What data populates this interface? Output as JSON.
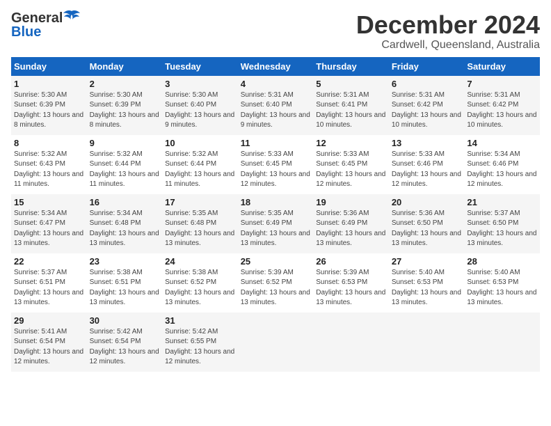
{
  "logo": {
    "general": "General",
    "blue": "Blue"
  },
  "title": "December 2024",
  "subtitle": "Cardwell, Queensland, Australia",
  "weekdays": [
    "Sunday",
    "Monday",
    "Tuesday",
    "Wednesday",
    "Thursday",
    "Friday",
    "Saturday"
  ],
  "weeks": [
    [
      {
        "day": "1",
        "sunrise": "5:30 AM",
        "sunset": "6:39 PM",
        "daylight": "13 hours and 8 minutes."
      },
      {
        "day": "2",
        "sunrise": "5:30 AM",
        "sunset": "6:39 PM",
        "daylight": "13 hours and 8 minutes."
      },
      {
        "day": "3",
        "sunrise": "5:30 AM",
        "sunset": "6:40 PM",
        "daylight": "13 hours and 9 minutes."
      },
      {
        "day": "4",
        "sunrise": "5:31 AM",
        "sunset": "6:40 PM",
        "daylight": "13 hours and 9 minutes."
      },
      {
        "day": "5",
        "sunrise": "5:31 AM",
        "sunset": "6:41 PM",
        "daylight": "13 hours and 10 minutes."
      },
      {
        "day": "6",
        "sunrise": "5:31 AM",
        "sunset": "6:42 PM",
        "daylight": "13 hours and 10 minutes."
      },
      {
        "day": "7",
        "sunrise": "5:31 AM",
        "sunset": "6:42 PM",
        "daylight": "13 hours and 10 minutes."
      }
    ],
    [
      {
        "day": "8",
        "sunrise": "5:32 AM",
        "sunset": "6:43 PM",
        "daylight": "13 hours and 11 minutes."
      },
      {
        "day": "9",
        "sunrise": "5:32 AM",
        "sunset": "6:44 PM",
        "daylight": "13 hours and 11 minutes."
      },
      {
        "day": "10",
        "sunrise": "5:32 AM",
        "sunset": "6:44 PM",
        "daylight": "13 hours and 11 minutes."
      },
      {
        "day": "11",
        "sunrise": "5:33 AM",
        "sunset": "6:45 PM",
        "daylight": "13 hours and 12 minutes."
      },
      {
        "day": "12",
        "sunrise": "5:33 AM",
        "sunset": "6:45 PM",
        "daylight": "13 hours and 12 minutes."
      },
      {
        "day": "13",
        "sunrise": "5:33 AM",
        "sunset": "6:46 PM",
        "daylight": "13 hours and 12 minutes."
      },
      {
        "day": "14",
        "sunrise": "5:34 AM",
        "sunset": "6:46 PM",
        "daylight": "13 hours and 12 minutes."
      }
    ],
    [
      {
        "day": "15",
        "sunrise": "5:34 AM",
        "sunset": "6:47 PM",
        "daylight": "13 hours and 13 minutes."
      },
      {
        "day": "16",
        "sunrise": "5:34 AM",
        "sunset": "6:48 PM",
        "daylight": "13 hours and 13 minutes."
      },
      {
        "day": "17",
        "sunrise": "5:35 AM",
        "sunset": "6:48 PM",
        "daylight": "13 hours and 13 minutes."
      },
      {
        "day": "18",
        "sunrise": "5:35 AM",
        "sunset": "6:49 PM",
        "daylight": "13 hours and 13 minutes."
      },
      {
        "day": "19",
        "sunrise": "5:36 AM",
        "sunset": "6:49 PM",
        "daylight": "13 hours and 13 minutes."
      },
      {
        "day": "20",
        "sunrise": "5:36 AM",
        "sunset": "6:50 PM",
        "daylight": "13 hours and 13 minutes."
      },
      {
        "day": "21",
        "sunrise": "5:37 AM",
        "sunset": "6:50 PM",
        "daylight": "13 hours and 13 minutes."
      }
    ],
    [
      {
        "day": "22",
        "sunrise": "5:37 AM",
        "sunset": "6:51 PM",
        "daylight": "13 hours and 13 minutes."
      },
      {
        "day": "23",
        "sunrise": "5:38 AM",
        "sunset": "6:51 PM",
        "daylight": "13 hours and 13 minutes."
      },
      {
        "day": "24",
        "sunrise": "5:38 AM",
        "sunset": "6:52 PM",
        "daylight": "13 hours and 13 minutes."
      },
      {
        "day": "25",
        "sunrise": "5:39 AM",
        "sunset": "6:52 PM",
        "daylight": "13 hours and 13 minutes."
      },
      {
        "day": "26",
        "sunrise": "5:39 AM",
        "sunset": "6:53 PM",
        "daylight": "13 hours and 13 minutes."
      },
      {
        "day": "27",
        "sunrise": "5:40 AM",
        "sunset": "6:53 PM",
        "daylight": "13 hours and 13 minutes."
      },
      {
        "day": "28",
        "sunrise": "5:40 AM",
        "sunset": "6:53 PM",
        "daylight": "13 hours and 13 minutes."
      }
    ],
    [
      {
        "day": "29",
        "sunrise": "5:41 AM",
        "sunset": "6:54 PM",
        "daylight": "13 hours and 12 minutes."
      },
      {
        "day": "30",
        "sunrise": "5:42 AM",
        "sunset": "6:54 PM",
        "daylight": "13 hours and 12 minutes."
      },
      {
        "day": "31",
        "sunrise": "5:42 AM",
        "sunset": "6:55 PM",
        "daylight": "13 hours and 12 minutes."
      },
      {
        "day": "",
        "sunrise": "",
        "sunset": "",
        "daylight": ""
      },
      {
        "day": "",
        "sunrise": "",
        "sunset": "",
        "daylight": ""
      },
      {
        "day": "",
        "sunrise": "",
        "sunset": "",
        "daylight": ""
      },
      {
        "day": "",
        "sunrise": "",
        "sunset": "",
        "daylight": ""
      }
    ]
  ]
}
